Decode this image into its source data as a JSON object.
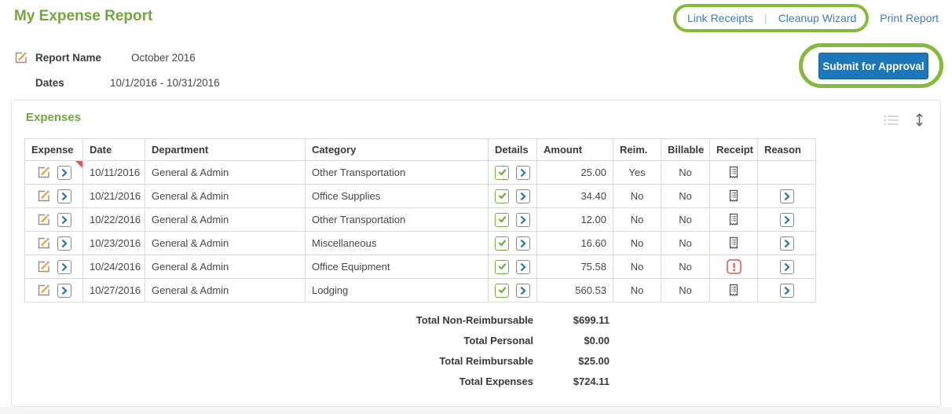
{
  "header": {
    "title": "My Expense Report",
    "links": {
      "link_receipts": "Link Receipts",
      "cleanup_wizard": "Cleanup Wizard",
      "print_report": "Print Report",
      "separator": "|"
    }
  },
  "report": {
    "name_label": "Report Name",
    "name_value": "October 2016",
    "dates_label": "Dates",
    "dates_value": "10/1/2016 - 10/31/2016",
    "submit_button": "Submit for Approval"
  },
  "expenses": {
    "heading": "Expenses",
    "columns": [
      "Expense",
      "Date",
      "Department",
      "Category",
      "Details",
      "Amount",
      "Reim.",
      "Billable",
      "Receipt",
      "Reason"
    ],
    "rows": [
      {
        "date": "10/11/2016",
        "department": "General & Admin",
        "category": "Other Transportation",
        "amount": "25.00",
        "reim": "Yes",
        "billable": "No",
        "receipt": "receipt",
        "has_reason": false,
        "flagged": true
      },
      {
        "date": "10/21/2016",
        "department": "General & Admin",
        "category": "Office Supplies",
        "amount": "34.40",
        "reim": "No",
        "billable": "No",
        "receipt": "receipt",
        "has_reason": true,
        "flagged": false
      },
      {
        "date": "10/22/2016",
        "department": "General & Admin",
        "category": "Other Transportation",
        "amount": "12.00",
        "reim": "No",
        "billable": "No",
        "receipt": "receipt",
        "has_reason": true,
        "flagged": false
      },
      {
        "date": "10/23/2016",
        "department": "General & Admin",
        "category": "Miscellaneous",
        "amount": "16.60",
        "reim": "No",
        "billable": "No",
        "receipt": "receipt",
        "has_reason": true,
        "flagged": false
      },
      {
        "date": "10/24/2016",
        "department": "General & Admin",
        "category": "Office Equipment",
        "amount": "75.58",
        "reim": "No",
        "billable": "No",
        "receipt": "alert",
        "has_reason": true,
        "flagged": false
      },
      {
        "date": "10/27/2016",
        "department": "General & Admin",
        "category": "Lodging",
        "amount": "560.53",
        "reim": "No",
        "billable": "No",
        "receipt": "receipt",
        "has_reason": true,
        "flagged": false
      }
    ],
    "totals": [
      {
        "label": "Total Non-Reimbursable",
        "value": "$699.11"
      },
      {
        "label": "Total Personal",
        "value": "$0.00"
      },
      {
        "label": "Total Reimbursable",
        "value": "$25.00"
      },
      {
        "label": "Total Expenses",
        "value": "$724.11"
      }
    ]
  },
  "icons": {
    "edit": "pencil-icon",
    "view": "chevron-right-icon",
    "details_complete": "check-icon",
    "receipt": "receipt-icon",
    "receipt_alert": "alert-icon",
    "panel_list": "list-icon",
    "panel_resize": "up-down-arrow-icon"
  },
  "colors": {
    "brand_green": "#74a63e",
    "annotation_green": "#84bb3c",
    "link_blue": "#3d7ebf",
    "button_blue": "#1b76ba",
    "alert_red": "#e4574e"
  }
}
